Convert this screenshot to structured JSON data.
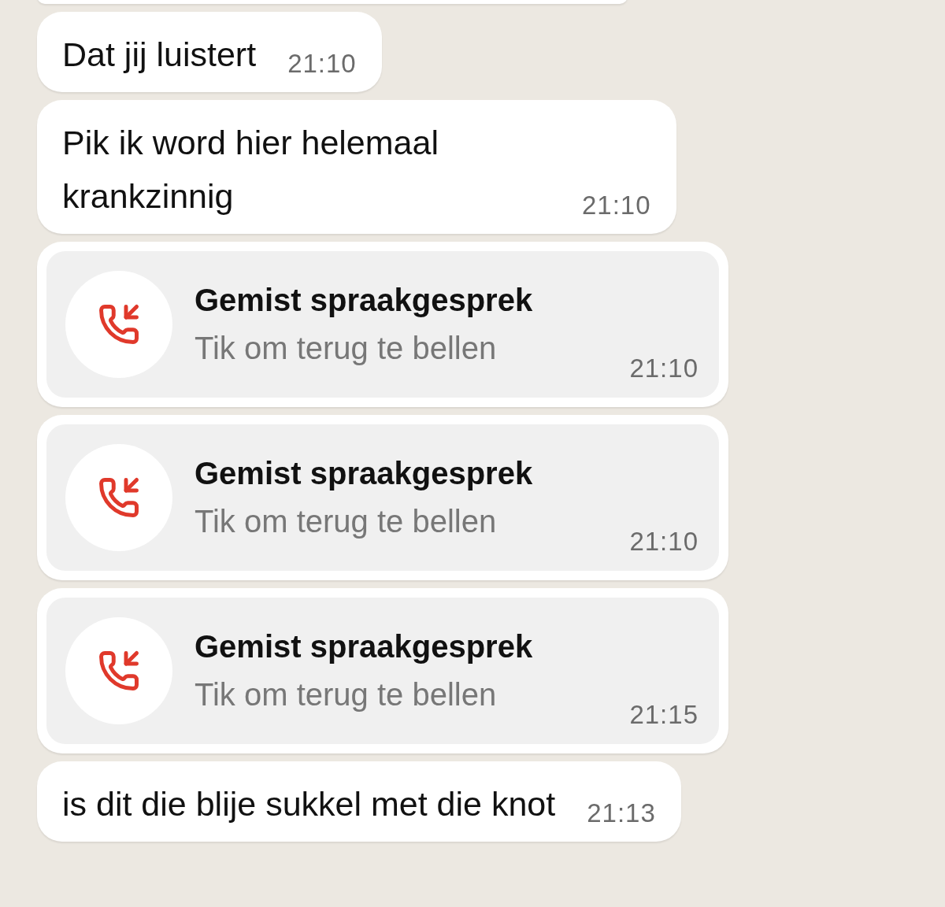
{
  "messages": [
    {
      "kind": "text",
      "text": "Dat jij luistert",
      "time": "21:10"
    },
    {
      "kind": "text",
      "text": "Pik ik word hier helemaal krankzinnig",
      "time": "21:10"
    },
    {
      "kind": "missed_call",
      "title": "Gemist spraakgesprek",
      "subtitle": "Tik om terug te bellen",
      "time": "21:10"
    },
    {
      "kind": "missed_call",
      "title": "Gemist spraakgesprek",
      "subtitle": "Tik om terug te bellen",
      "time": "21:10"
    },
    {
      "kind": "missed_call",
      "title": "Gemist spraakgesprek",
      "subtitle": "Tik om terug te bellen",
      "time": "21:15"
    },
    {
      "kind": "text",
      "text": "is dit die blije sukkel met die knot",
      "time": "21:13"
    }
  ]
}
